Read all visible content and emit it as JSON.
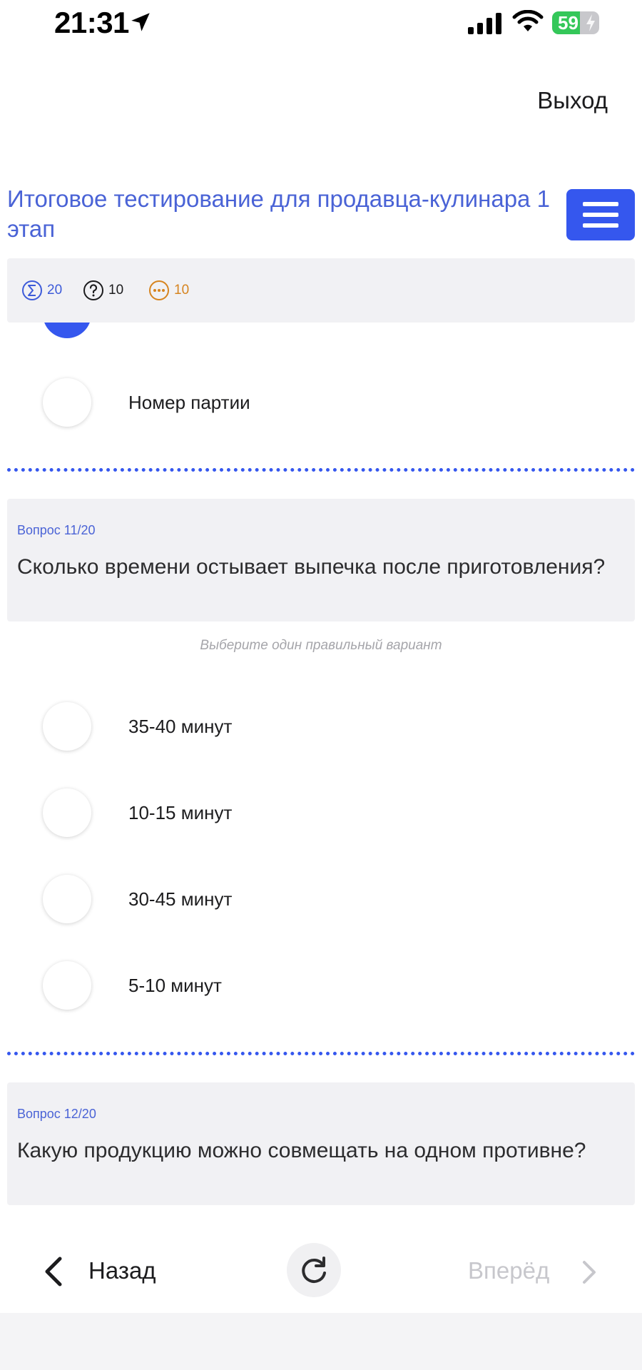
{
  "status_bar": {
    "time": "21:31",
    "battery_percent": "59",
    "battery_level": 0.59,
    "icons": [
      "location-arrow-icon",
      "cellular-signal-icon",
      "wifi-icon",
      "battery-charging-icon"
    ]
  },
  "header": {
    "exit_label": "Выход",
    "title": " Итоговое тестирование для продавца-кулинара 1 этап",
    "menu_icon": "hamburger-menu-icon"
  },
  "stats": {
    "total": "20",
    "unanswered": "10",
    "skipped": "10",
    "colors": {
      "total": "#3d5bd9",
      "unanswered": "#1c1c1e",
      "skipped": "#d6841f"
    }
  },
  "prev_question": {
    "options": [
      {
        "label": "",
        "selected": true
      },
      {
        "label": "Номер партии",
        "selected": false
      }
    ]
  },
  "question_11": {
    "number": "Вопрос 11/20",
    "text": "Сколько времени остывает выпечка после приготовления?",
    "hint": "Выберите один правильный вариант",
    "options": [
      {
        "label": "35-40 минут",
        "selected": false
      },
      {
        "label": "10-15 минут",
        "selected": false
      },
      {
        "label": "30-45 минут",
        "selected": false
      },
      {
        "label": "5-10 минут",
        "selected": false
      }
    ]
  },
  "question_12": {
    "number": "Вопрос 12/20",
    "text": "Какую продукцию можно совмещать на одном противне?"
  },
  "navigation": {
    "back_label": "Назад",
    "forward_label": "Вперёд",
    "refresh_icon": "refresh-icon"
  },
  "colors": {
    "accent": "#3557ee",
    "title": "#4a63d6",
    "card_bg": "#f1f1f4",
    "disabled": "#c7c7cc"
  }
}
